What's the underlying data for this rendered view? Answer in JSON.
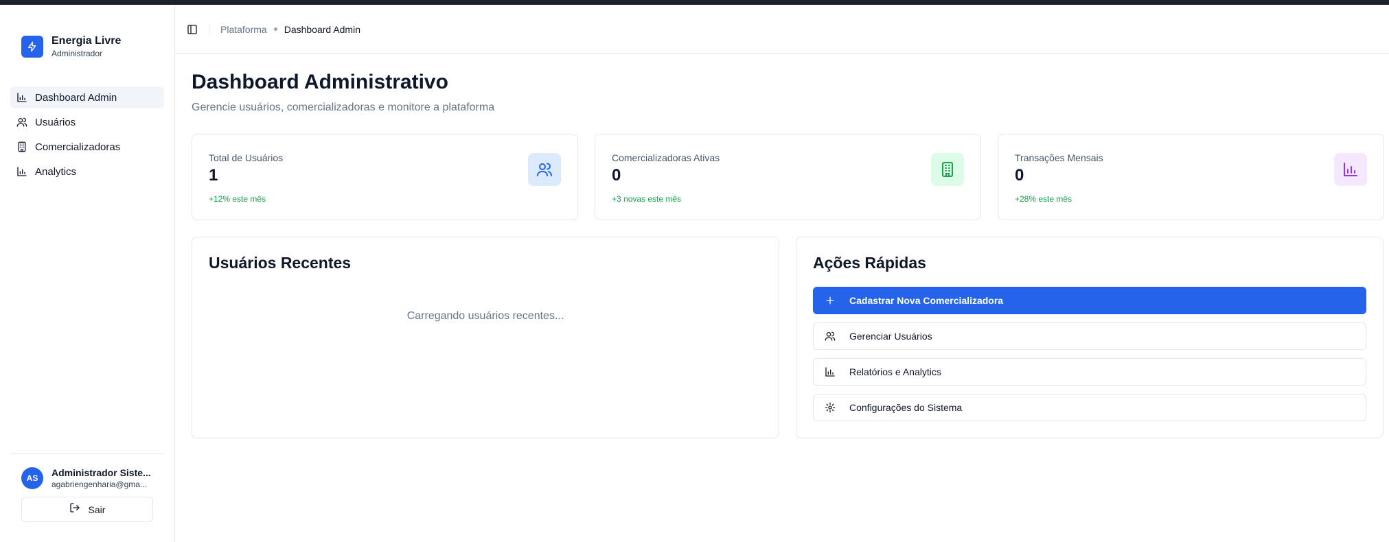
{
  "app": {
    "name": "Energia Livre",
    "role": "Administrador"
  },
  "sidebar": {
    "items": [
      {
        "label": "Dashboard Admin",
        "icon": "bar-chart-icon",
        "active": true
      },
      {
        "label": "Usuários",
        "icon": "users-icon",
        "active": false
      },
      {
        "label": "Comercializadoras",
        "icon": "building-icon",
        "active": false
      },
      {
        "label": "Analytics",
        "icon": "bar-chart-icon",
        "active": false
      }
    ]
  },
  "user": {
    "initials": "AS",
    "name": "Administrador Siste...",
    "email": "agabriengenharia@gma...",
    "logout_label": "Sair"
  },
  "header": {
    "breadcrumb": [
      "Plataforma",
      "Dashboard Admin"
    ]
  },
  "page": {
    "title": "Dashboard Administrativo",
    "subtitle": "Gerencie usuários, comercializadoras e monitore a plataforma"
  },
  "stats": [
    {
      "label": "Total de Usuários",
      "value": "1",
      "trend": "+12% este mês",
      "icon": "users-icon",
      "icon_bg": "#dbeafe",
      "icon_color": "#2563eb"
    },
    {
      "label": "Comercializadoras Ativas",
      "value": "0",
      "trend": "+3 novas este mês",
      "icon": "building-icon",
      "icon_bg": "#dcfce7",
      "icon_color": "#16a34a"
    },
    {
      "label": "Transações Mensais",
      "value": "0",
      "trend": "+28% este mês",
      "icon": "bar-chart-icon",
      "icon_bg": "#f3e8ff",
      "icon_color": "#9333ea"
    }
  ],
  "recent_users": {
    "title": "Usuários Recentes",
    "loading_text": "Carregando usuários recentes..."
  },
  "quick_actions": {
    "title": "Ações Rápidas",
    "items": [
      {
        "label": "Cadastrar Nova Comercializadora",
        "icon": "plus-icon",
        "primary": true
      },
      {
        "label": "Gerenciar Usuários",
        "icon": "users-icon",
        "primary": false
      },
      {
        "label": "Relatórios e Analytics",
        "icon": "bar-chart-icon",
        "primary": false
      },
      {
        "label": "Configurações do Sistema",
        "icon": "gear-icon",
        "primary": false
      }
    ]
  },
  "colors": {
    "accent": "#2563eb",
    "trend": "#16a34a"
  }
}
